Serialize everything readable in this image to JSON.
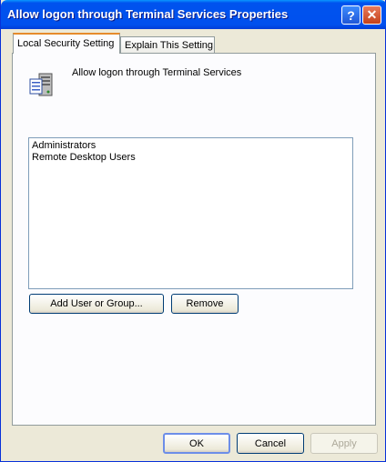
{
  "window": {
    "title": "Allow logon through Terminal Services Properties"
  },
  "titlebar_buttons": {
    "help": "?",
    "close": "✕"
  },
  "tabs": [
    {
      "label": "Local Security Setting",
      "active": true
    },
    {
      "label": "Explain This Setting",
      "active": false
    }
  ],
  "policy": {
    "name": "Allow logon through Terminal Services",
    "icon": "policy-server-icon"
  },
  "members": [
    "Administrators",
    "Remote Desktop Users"
  ],
  "buttons": {
    "add": "Add User or Group...",
    "remove": "Remove",
    "ok": "OK",
    "cancel": "Cancel",
    "apply": "Apply"
  },
  "colors": {
    "titlebar": "#0053ee",
    "face": "#ece9d8",
    "tab_accent": "#e68b2c"
  }
}
